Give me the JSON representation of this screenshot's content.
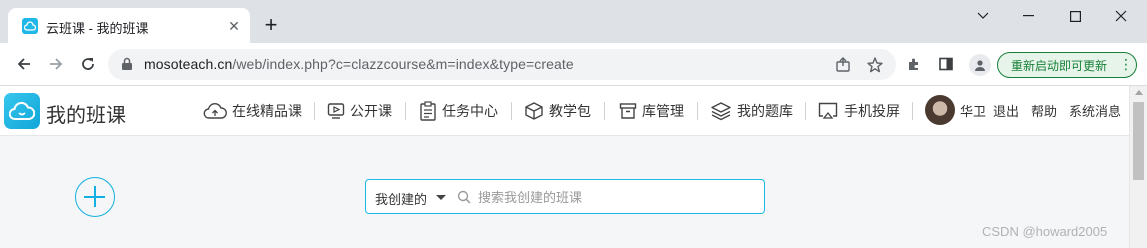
{
  "browser": {
    "tab": {
      "title": "云班课 - 我的班课",
      "close": "✕"
    },
    "new_tab": "+",
    "url": {
      "host": "mosoteach.cn",
      "path": "/web/index.php?c=clazzcourse&m=index&type=create"
    },
    "update_button": "重新启动即可更新",
    "menu_glyph": "⋮",
    "icons": [
      "back-icon",
      "forward-icon",
      "reload-icon",
      "lock-icon",
      "share-icon",
      "star-icon",
      "extensions-icon",
      "side-panel-icon",
      "profile-icon",
      "minimize-icon",
      "maximize-icon",
      "close-icon"
    ]
  },
  "site": {
    "logo_text": "我的班课",
    "nav": [
      {
        "label": "在线精品课",
        "icon": "cloud-icon"
      },
      {
        "label": "公开课",
        "icon": "video-icon"
      },
      {
        "label": "任务中心",
        "icon": "clipboard-icon"
      },
      {
        "label": "教学包",
        "icon": "package-icon"
      },
      {
        "label": "库管理",
        "icon": "archive-icon"
      },
      {
        "label": "我的题库",
        "icon": "layers-icon"
      },
      {
        "label": "手机投屏",
        "icon": "screen-cast-icon"
      }
    ],
    "user": {
      "name": "华卫"
    },
    "logout": "退出",
    "help": "帮助",
    "messages": "系统消息"
  },
  "search": {
    "filter": "我创建的",
    "placeholder": "搜索我创建的班课"
  },
  "watermark": "CSDN @howard2005",
  "colors": {
    "accent": "#1fb7e8",
    "update_green": "#188038"
  }
}
